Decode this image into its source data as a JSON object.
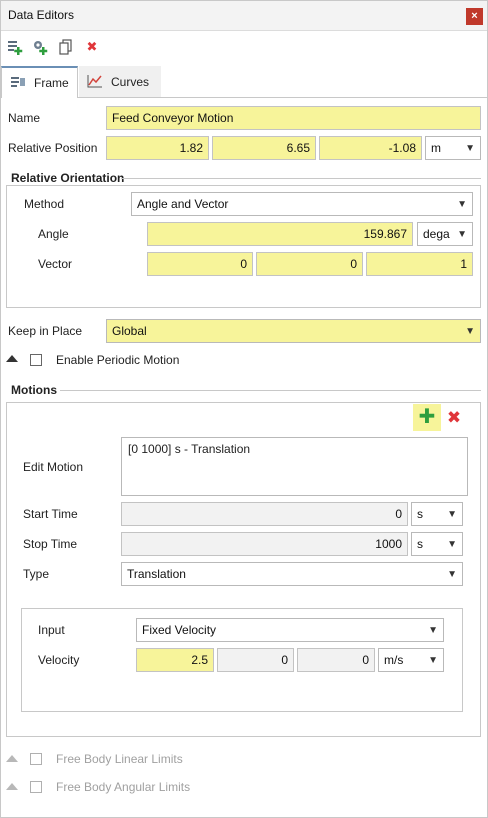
{
  "window": {
    "title": "Data Editors",
    "close_glyph": "×"
  },
  "toolbar": {
    "icons": [
      "add-data-icon",
      "add-linked-icon",
      "copy-icon",
      "delete-icon"
    ],
    "delete_glyph": "✖"
  },
  "tabs": [
    {
      "label": "Frame",
      "icon": "frame-icon",
      "active": true
    },
    {
      "label": "Curves",
      "icon": "curves-icon",
      "active": false
    }
  ],
  "frame": {
    "name_label": "Name",
    "name_value": "Feed Conveyor Motion",
    "relpos_label": "Relative Position",
    "relpos_values": [
      "1.82",
      "6.65",
      "-1.08"
    ],
    "relpos_unit": "m"
  },
  "orientation": {
    "title": "Relative Orientation",
    "method_label": "Method",
    "method_value": "Angle and Vector",
    "angle_label": "Angle",
    "angle_value": "159.867",
    "angle_unit": "dega",
    "vector_label": "Vector",
    "vector_values": [
      "0",
      "0",
      "1"
    ]
  },
  "keep_in_place": {
    "label": "Keep in Place",
    "value": "Global"
  },
  "periodic": {
    "label": "Enable Periodic Motion",
    "checked": false
  },
  "motions": {
    "title": "Motions",
    "add_glyph": "✚",
    "remove_glyph": "✖",
    "edit_label": "Edit Motion",
    "edit_items": [
      "[0 1000] s - Translation"
    ],
    "start_label": "Start Time",
    "start_value": "0",
    "start_unit": "s",
    "stop_label": "Stop Time",
    "stop_value": "1000",
    "stop_unit": "s",
    "type_label": "Type",
    "type_value": "Translation",
    "input_label": "Input",
    "input_value": "Fixed Velocity",
    "velocity_label": "Velocity",
    "velocity_values": [
      "2.5",
      "0",
      "0"
    ],
    "velocity_unit": "m/s"
  },
  "limits": {
    "linear_label": "Free Body Linear Limits",
    "angular_label": "Free Body Angular Limits"
  },
  "colors": {
    "highlight": "#f7f49a",
    "accent_tab": "#6a8fb5",
    "add_green": "#2e9e3e",
    "remove_red": "#e0363a"
  }
}
